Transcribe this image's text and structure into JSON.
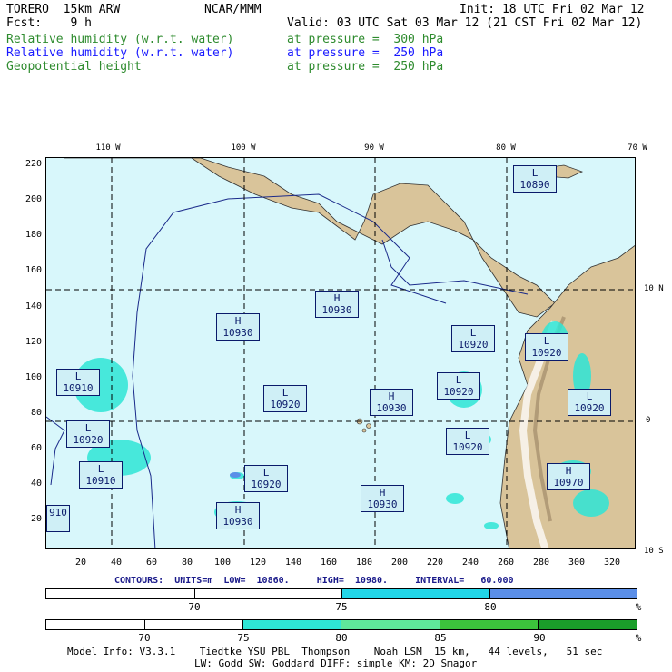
{
  "header": {
    "model": "TORERO  15km ARW",
    "center": "NCAR/MMM",
    "init": "Init: 18 UTC Fri 02 Mar 12",
    "fcst": "Fcst:    9 h",
    "valid": "Valid: 03 UTC Sat 03 Mar 12 (21 CST Fri 02 Mar 12)",
    "fields": [
      {
        "name": "Relative humidity (w.r.t. water)",
        "level": "at pressure =  300 hPa",
        "color": "#2e8b2e"
      },
      {
        "name": "Relative humidity (w.r.t. water)",
        "level": "at pressure =  250 hPa",
        "color": "#1a1aff"
      },
      {
        "name": "Geopotential height",
        "level": "at pressure =  250 hPa",
        "color": "#2e8b2e"
      }
    ]
  },
  "axes": {
    "top": [
      "110 W",
      "100 W",
      "90 W",
      "80 W",
      "70 W"
    ],
    "left": [
      "220",
      "200",
      "180",
      "160",
      "140",
      "120",
      "100",
      "80",
      "60",
      "40",
      "20"
    ],
    "bottom": [
      "20",
      "40",
      "60",
      "80",
      "100",
      "120",
      "140",
      "160",
      "180",
      "200",
      "220",
      "240",
      "260",
      "280",
      "300",
      "320"
    ],
    "right": [
      "10 N",
      "0",
      "10 S"
    ]
  },
  "centers": [
    {
      "type": "L",
      "value": "10890"
    },
    {
      "type": "H",
      "value": "10930"
    },
    {
      "type": "H",
      "value": "10930"
    },
    {
      "type": "L",
      "value": "10920"
    },
    {
      "type": "L",
      "value": "10920"
    },
    {
      "type": "L",
      "value": "10910"
    },
    {
      "type": "L",
      "value": "10920"
    },
    {
      "type": "H",
      "value": "10930"
    },
    {
      "type": "L",
      "value": "10920"
    },
    {
      "type": "L",
      "value": "10920"
    },
    {
      "type": "L",
      "value": "10920"
    },
    {
      "type": "L",
      "value": "10920"
    },
    {
      "type": "L",
      "value": "10910"
    },
    {
      "type": "L",
      "value": "10920"
    },
    {
      "type": "H",
      "value": "10970"
    },
    {
      "type": "H",
      "value": "10930"
    },
    {
      "type": "H",
      "value": "10930"
    },
    {
      "type": "",
      "value": "910"
    }
  ],
  "contours": {
    "label": "CONTOURS:  UNITS=m  LOW=  10860.     HIGH=  10980.     INTERVAL=   60.000"
  },
  "colorbar1": {
    "labels": [
      "70",
      "75",
      "80"
    ],
    "unit": "%",
    "colors": [
      "#ffffff",
      "#ffffff",
      "#22d6e8",
      "#5b8fe8"
    ]
  },
  "colorbar2": {
    "labels": [
      "70",
      "75",
      "80",
      "85",
      "90"
    ],
    "unit": "%",
    "colors": [
      "#ffffff",
      "#ffffff",
      "#2ee6d6",
      "#5fe89a",
      "#3cc43c",
      "#1a9e2a"
    ]
  },
  "footer": {
    "line1": "Model Info: V3.3.1    Tiedtke YSU PBL  Thompson    Noah LSM  15 km,   44 levels,   51 sec",
    "line2": "LW: Godd SW: Goddard DIFF: simple KM: 2D Smagor"
  }
}
